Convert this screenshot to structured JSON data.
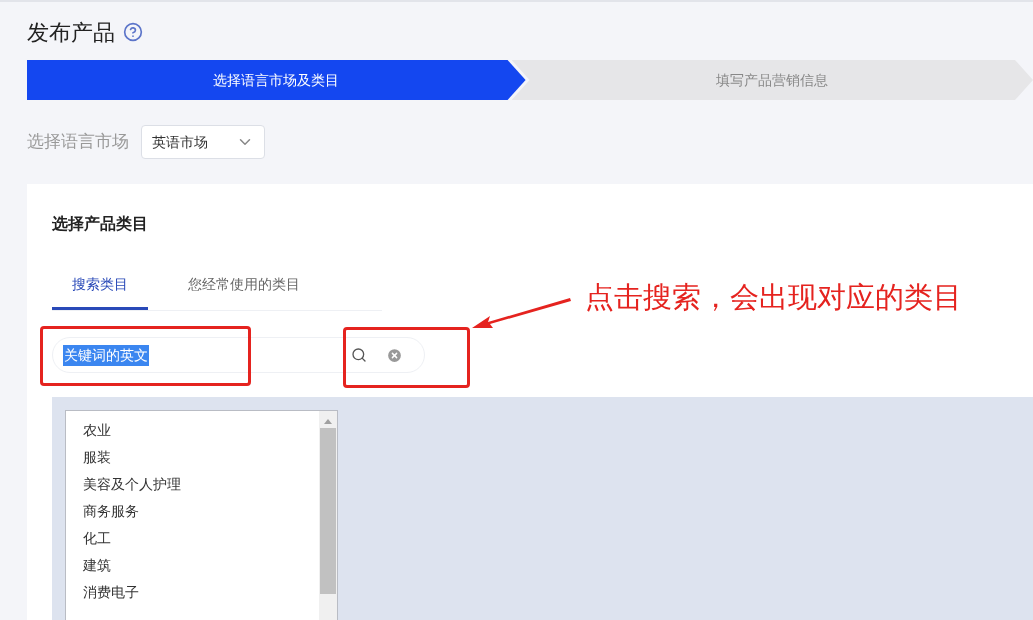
{
  "page": {
    "title": "发布产品"
  },
  "steps": [
    {
      "label": "选择语言市场及类目",
      "selected": true
    },
    {
      "label": "填写产品营销信息",
      "selected": false
    }
  ],
  "market": {
    "label": "选择语言市场",
    "value": "英语市场"
  },
  "category_panel": {
    "title": "选择产品类目",
    "tabs": [
      {
        "label": "搜索类目",
        "selected": true
      },
      {
        "label": "您经常使用的类目",
        "selected": false
      }
    ],
    "search": {
      "value": "关键词的英文"
    },
    "categories": [
      "农业",
      "服装",
      "美容及个人护理",
      "商务服务",
      "化工",
      "建筑",
      "消费电子"
    ]
  },
  "annotation": {
    "text": "点击搜索，会出现对应的类目"
  }
}
